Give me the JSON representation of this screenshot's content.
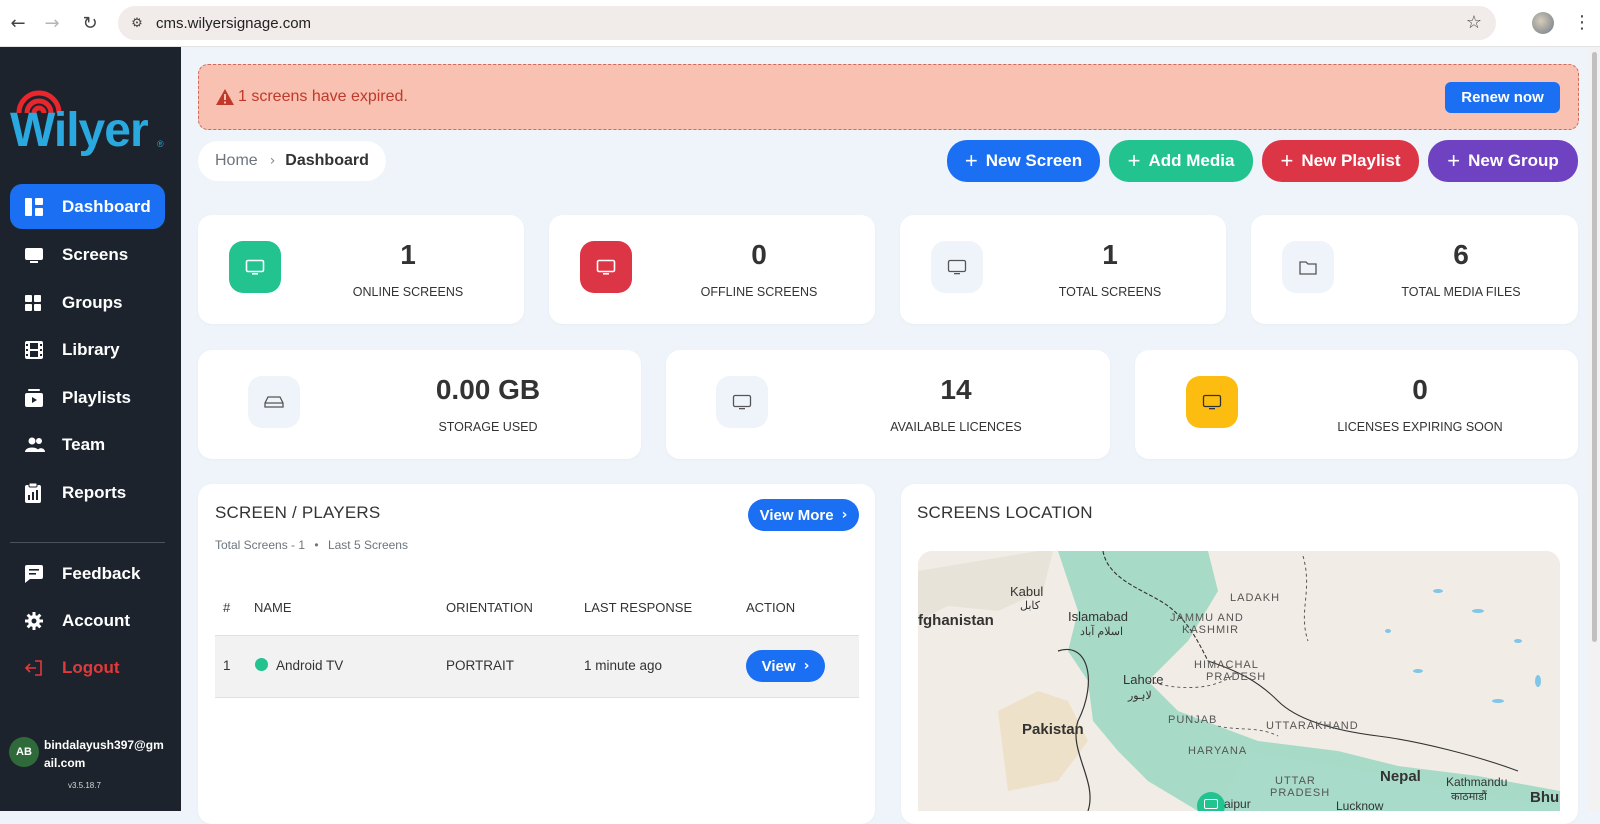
{
  "browser": {
    "url": "cms.wilyersignage.com"
  },
  "sidebar": {
    "logo_text": "Wilyer",
    "logo_reg": "®",
    "items": [
      {
        "label": "Dashboard"
      },
      {
        "label": "Screens"
      },
      {
        "label": "Groups"
      },
      {
        "label": "Library"
      },
      {
        "label": "Playlists"
      },
      {
        "label": "Team"
      },
      {
        "label": "Reports"
      },
      {
        "label": "Feedback"
      },
      {
        "label": "Account"
      },
      {
        "label": "Logout"
      }
    ],
    "user_initials": "AB",
    "user_email": "bindalayush397@gmail.com",
    "version": "v3.5.18.7"
  },
  "alert": {
    "text": "1 screens have expired.",
    "button": "Renew now"
  },
  "breadcrumb": {
    "home": "Home",
    "current": "Dashboard"
  },
  "actions": {
    "new_screen": "New Screen",
    "add_media": "Add Media",
    "new_playlist": "New Playlist",
    "new_group": "New Group"
  },
  "stats": [
    {
      "value": "1",
      "label": "ONLINE SCREENS"
    },
    {
      "value": "0",
      "label": "OFFLINE SCREENS"
    },
    {
      "value": "1",
      "label": "TOTAL SCREENS"
    },
    {
      "value": "6",
      "label": "TOTAL MEDIA FILES"
    },
    {
      "value": "0.00 GB",
      "label": "STORAGE USED"
    },
    {
      "value": "14",
      "label": "AVAILABLE LICENCES"
    },
    {
      "value": "0",
      "label": "LICENSES EXPIRING SOON"
    }
  ],
  "players": {
    "title": "SCREEN / PLAYERS",
    "subtitle_total": "Total Screens - 1",
    "subtitle_sep": "•",
    "subtitle_last": "Last 5 Screens",
    "view_more": "View More",
    "columns": [
      "#",
      "NAME",
      "ORIENTATION",
      "LAST RESPONSE",
      "ACTION"
    ],
    "rows": [
      {
        "index": "1",
        "name": "Android TV",
        "orientation": "PORTRAIT",
        "last_response": "1 minute ago",
        "action": "View",
        "status_color": "#22c38e"
      }
    ]
  },
  "location": {
    "title": "SCREENS LOCATION",
    "map_labels": {
      "kabul": "Kabul",
      "kabul_local": "کابل",
      "afghanistan": "fghanistan",
      "islamabad": "Islamabad",
      "islamabad_local": "اسلام آباد",
      "ladakh": "LADAKH",
      "jammu": "JAMMU AND",
      "kashmir": "KASHMIR",
      "himachal": "HIMACHAL",
      "pradesh": "PRADESH",
      "lahore": "Lahore",
      "lahore_local": "لاہور",
      "pakistan": "Pakistan",
      "punjab": "PUNJAB",
      "uttarakhand": "UTTARAKHAND",
      "haryana": "HARYANA",
      "uttar": "UTTAR",
      "pradesh2": "PRADESH",
      "nepal": "Nepal",
      "kathmandu": "Kathmandu",
      "kathmandu_local": "काठमाडौं",
      "bhu": "Bhu",
      "jaipur": "aipur",
      "lucknow": "Lucknow"
    }
  },
  "colors": {
    "primary": "#1a6ff3",
    "success": "#22c38e",
    "danger": "#dc3545",
    "purple": "#6f42c1",
    "warning": "#fdbd10",
    "sidebar": "#1c232c"
  }
}
